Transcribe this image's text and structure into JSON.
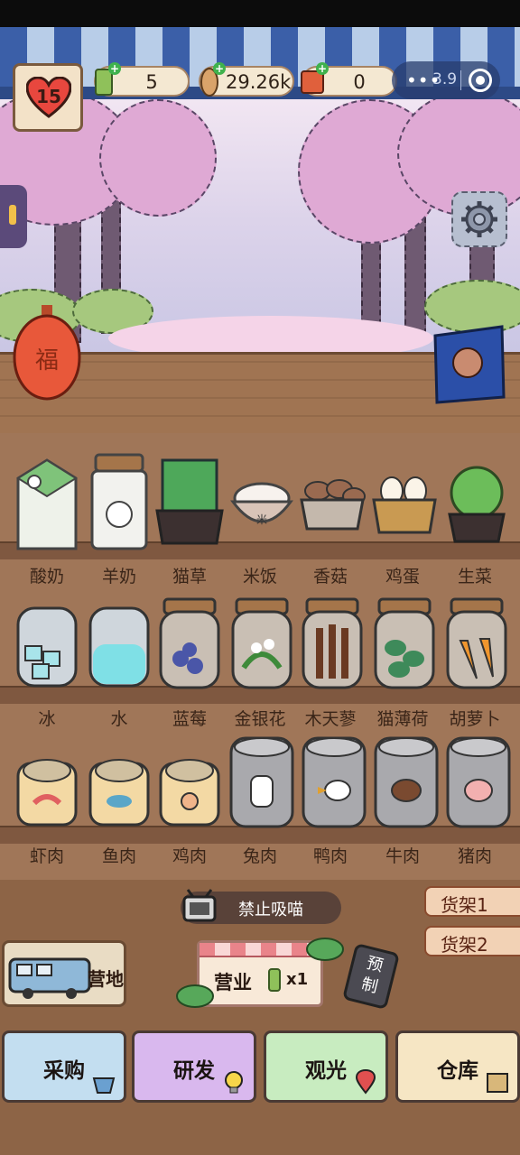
{
  "hud": {
    "hearts": "15",
    "resources": [
      {
        "name": "cat-mint-currency",
        "value": "5"
      },
      {
        "name": "dried-fish-currency",
        "value": "29.26k"
      },
      {
        "name": "ticket-currency",
        "value": "0"
      }
    ],
    "capsule_dots": "•••",
    "capsule_version": "3.9"
  },
  "shelf_rows": [
    {
      "items": [
        "酸奶",
        "羊奶",
        "猫草",
        "米饭",
        "香菇",
        "鸡蛋",
        "生菜"
      ]
    },
    {
      "items": [
        "冰",
        "水",
        "蓝莓",
        "金银花",
        "木天蓼",
        "猫薄荷",
        "胡萝卜"
      ]
    },
    {
      "items": [
        "虾肉",
        "鱼肉",
        "鸡肉",
        "兔肉",
        "鸭肉",
        "牛肉",
        "猪肉"
      ]
    }
  ],
  "lantern_char": "福",
  "rice_char": "米",
  "tv_text": "禁止吸喵",
  "shelf_tabs": [
    "货架1",
    "货架2"
  ],
  "camp_label": "营地",
  "open_label": "营业",
  "open_mult": "x1",
  "preset_label": "预制",
  "nav": [
    "采购",
    "研发",
    "观光",
    "仓库"
  ],
  "colors": {
    "nav_purchase": "#c3def0",
    "nav_research": "#d9b8ee",
    "nav_tour": "#c8ecc0",
    "nav_warehouse": "#f6e6c4",
    "heart": "#e8473e"
  }
}
